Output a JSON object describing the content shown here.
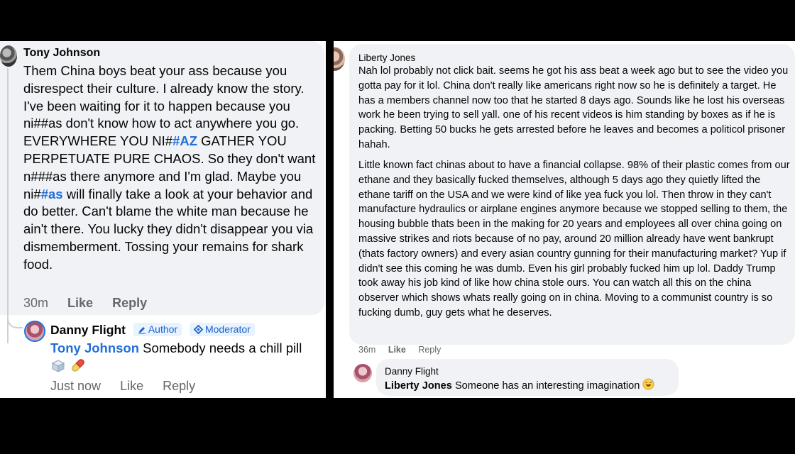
{
  "left": {
    "comment": {
      "author": "Tony Johnson",
      "segments": [
        {
          "t": "Them China boys beat your ass because you disrespect their culture. I already know the story. I've been waiting for it to happen because you ni##as don't know how to act anywhere you go. EVERYWHERE YOU NI#",
          "tag": false
        },
        {
          "t": "#AZ",
          "tag": true
        },
        {
          "t": " GATHER YOU PERPETUATE PURE CHAOS. So they don't want n###as there anymore and I'm glad. Maybe you ni#",
          "tag": false
        },
        {
          "t": "#as",
          "tag": true
        },
        {
          "t": " will finally take a look at your behavior and do better. Can't blame the white man because he ain't there. You lucky they didn't disappear you via dismemberment. Tossing your remains for shark food.",
          "tag": false
        }
      ],
      "time": "30m",
      "like_label": "Like",
      "reply_label": "Reply"
    },
    "reply": {
      "author": "Danny Flight",
      "badge_author": "Author",
      "badge_moderator": "Moderator",
      "mention": "Tony Johnson",
      "text": " Somebody needs a chill pill",
      "time": "Just now",
      "like_label": "Like",
      "reply_label": "Reply"
    }
  },
  "right": {
    "comment": {
      "author": "Liberty Jones",
      "paragraph1": "Nah lol probably not click bait. seems he got his ass beat a week ago but to see the video you gotta pay for it lol. China don't really like americans right now so he is definitely a target. He has a members channel now too that he started 8 days ago. Sounds like he lost his overseas work he been trying to sell yall. one of his recent videos is him standing by boxes as if he is packing. Betting 50 bucks he gets arrested before he leaves and becomes a politicol prisoner hahah.",
      "paragraph2": "Little known fact chinas about to have a financial collapse. 98% of their plastic comes from our ethane and they basically fucked themselves, although 5 days ago they quietly lifted the ethane tariff on the USA and we were kind of like yea fuck you lol. Then throw in they can't manufacture hydraulics or airplane engines anymore because we stopped selling to them, the housing bubble thats been in the making for 20 years and employees all over china going on massive strikes and riots because of no pay, around 20 million already have went bankrupt (thats factory owners) and every asian country gunning for their manufacturing market? Yup if didn't see this coming he was dumb. Even his girl probably fucked him up lol. Daddy Trump took away his job kind of like how china stole ours. You can watch all this on the china observer which shows whats really going on in china. Moving to a communist country is so fucking dumb, guy gets what he deserves.",
      "time": "36m",
      "like_label": "Like",
      "reply_label": "Reply"
    },
    "reply": {
      "author": "Danny Flight",
      "mention": "Liberty Jones",
      "text": " Someone has an interesting imagination"
    }
  },
  "icons": [
    "pencil-icon",
    "moderator-icon",
    "ice-cube-emoji",
    "pill-emoji",
    "grinning-sweat-emoji"
  ],
  "colors": {
    "link": "#216fdb",
    "bubble": "#f0f2f5",
    "muted": "#65676b",
    "badge_bg": "#e7f3ff"
  }
}
